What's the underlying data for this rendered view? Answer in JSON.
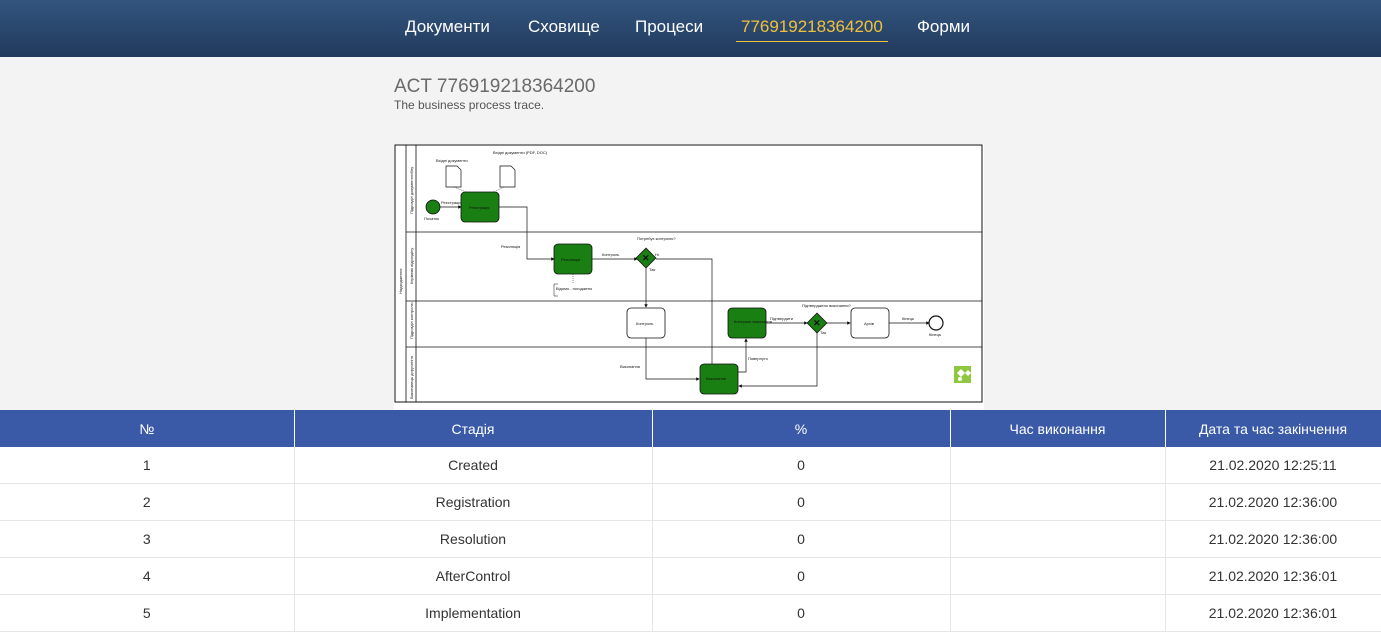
{
  "nav": {
    "items": [
      "Документи",
      "Сховище",
      "Процеси",
      "776919218364200",
      "Форми"
    ],
    "active_index": 3
  },
  "page": {
    "title": "ACT 776919218364200",
    "subtitle": "The business process trace."
  },
  "diagram": {
    "colors": {
      "done": "#1a7f12",
      "pending": "#ffffff",
      "border": "#111111"
    },
    "pools": [
      "Підрозділ документообігу",
      "Керівник підрозділу",
      "Підрозділ контролю",
      "Виконавець доручення"
    ],
    "pool_group": "Надходження",
    "documents": [
      "Вхідні документи",
      "Вхідні документи (PDF, DOC)"
    ],
    "tasks": {
      "registration": "Реєстрація",
      "resolution": "Резолюція",
      "control": "Контроль",
      "control_done": "Контроль виконання",
      "execution": "Виконання",
      "archive": "Архів"
    },
    "gateways": {
      "needs_control": "Потребує контролю?",
      "confirmed": "Підтверджено виконання?"
    },
    "events": {
      "start": "Початок",
      "end": "Кінець"
    },
    "flows": {
      "registered": "Реєстрація",
      "resolution": "Резолюція",
      "control": "Контроль",
      "execute": "Виконання",
      "confirm": "Підтвердити",
      "yes": "Так",
      "no": "Ні",
      "end": "Кінець",
      "returned": "Повернуто"
    },
    "annotation": "Відомо - погоджено"
  },
  "table": {
    "columns": [
      "№",
      "Стадія",
      "%",
      "Час виконання",
      "Дата та час закінчення"
    ],
    "rows": [
      {
        "num": "1",
        "stage": "Created",
        "percent": "0",
        "duration": "",
        "finished": "21.02.2020 12:25:11"
      },
      {
        "num": "2",
        "stage": "Registration",
        "percent": "0",
        "duration": "",
        "finished": "21.02.2020 12:36:00"
      },
      {
        "num": "3",
        "stage": "Resolution",
        "percent": "0",
        "duration": "",
        "finished": "21.02.2020 12:36:00"
      },
      {
        "num": "4",
        "stage": "AfterControl",
        "percent": "0",
        "duration": "",
        "finished": "21.02.2020 12:36:01"
      },
      {
        "num": "5",
        "stage": "Implementation",
        "percent": "0",
        "duration": "",
        "finished": "21.02.2020 12:36:01"
      }
    ]
  }
}
